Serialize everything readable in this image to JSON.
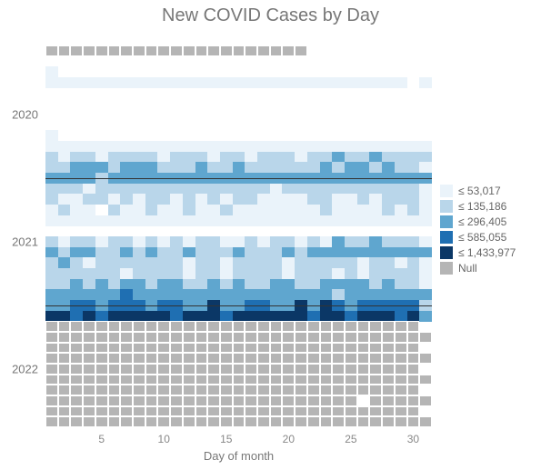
{
  "title": "New COVID Cases by Day",
  "xlabel": "Day of month",
  "xticks": [
    5,
    10,
    15,
    20,
    25,
    30
  ],
  "ylabels": [
    {
      "text": "2020",
      "row": 6
    },
    {
      "text": "2021",
      "row": 18
    },
    {
      "text": "2022",
      "row": 30
    }
  ],
  "legend": [
    {
      "label": "≤ 53,017",
      "color": "#eaf3fa"
    },
    {
      "label": "≤ 135,186",
      "color": "#b9d6ea"
    },
    {
      "label": "≤ 296,405",
      "color": "#5fa6cf"
    },
    {
      "label": "≤ 585,055",
      "color": "#1f6fb2"
    },
    {
      "label": "≤ 1,433,977",
      "color": "#0b3766"
    },
    {
      "label": "Null",
      "color": "#b5b5b5"
    }
  ],
  "chart_data": {
    "type": "heatmap",
    "xlabel": "Day of month",
    "x_range": [
      1,
      31
    ],
    "rows": 36,
    "row_meaning": "each row = one calendar month, Jan-2020 .. Dec-2022 plus 2 padding rows top/bottom",
    "bins": {
      "0": {
        "max": 53017,
        "color": "#eaf3fa"
      },
      "1": {
        "max": 135186,
        "color": "#b9d6ea"
      },
      "2": {
        "max": 296405,
        "color": "#5fa6cf"
      },
      "3": {
        "max": 585055,
        "color": "#1f6fb2"
      },
      "4": {
        "max": 1433977,
        "color": "#0b3766"
      },
      "N": {
        "meaning": "null / no data",
        "color": "#b5b5b5"
      }
    },
    "grid": [
      "NNNNNNNNNNNNNNNNNNNNN__________",
      "_______________________________",
      "0______________________________",
      "00000000000000000000000000000_0",
      "_______________________________",
      "_______________________________",
      "_______________________________",
      "_______________________________",
      "0______________________________",
      "0000000000000000000000000000000",
      "1011011110111011011101121121111",
      "1122212221112112111111212212110",
      "2222122222222222222222222222222",
      "1110111111111111110111111111110",
      "1001101011010101100001100101110",
      "0100_10010010010000000100001010",
      "0000000000000000000000000000000",
      "_______________________________",
      "1011011010101100101101021121110",
      "2122112121121112111212222222222",
      "1210111111101101111011111011010",
      "1111110111101101111011101011110",
      "1121212212211212112211222212110",
      "2222223222222222222222212222222",
      "2233233323322422332242432333331",
      "4434344444344434444443443444342",
      "NNNNNNNNNNNNNNNNNNNNNNNNNNNNNN_",
      "NNNNNNNNNNNNNNNNNNNNNNNNNNNNNNN",
      "NNNNNNNNNNNNNNNNNNNNNNNNNNNNNN_",
      "NNNNNNNNNNNNNNNNNNNNNNNNNNNNNNN",
      "NNNNNNNNNNNNNNNNNNNNNNNNNNNNNN_",
      "NNNNNNNNNNNNNNNNNNNNNNNNNNNNNNN",
      "NNNNNNNNNNNNNNNNNNNNNNNNNNNNNN_",
      "NNNNNNNNNNNNNNNNNNNNNNNNN_NNNNN",
      "NNNNNNNNNNNNNNNNNNNNNNNNNNNNNN_",
      "NNNNNNNNNNNNNNNNNNNNNNNNNNNNNNN"
    ],
    "hr_lines_after_row": [
      12,
      24
    ]
  }
}
